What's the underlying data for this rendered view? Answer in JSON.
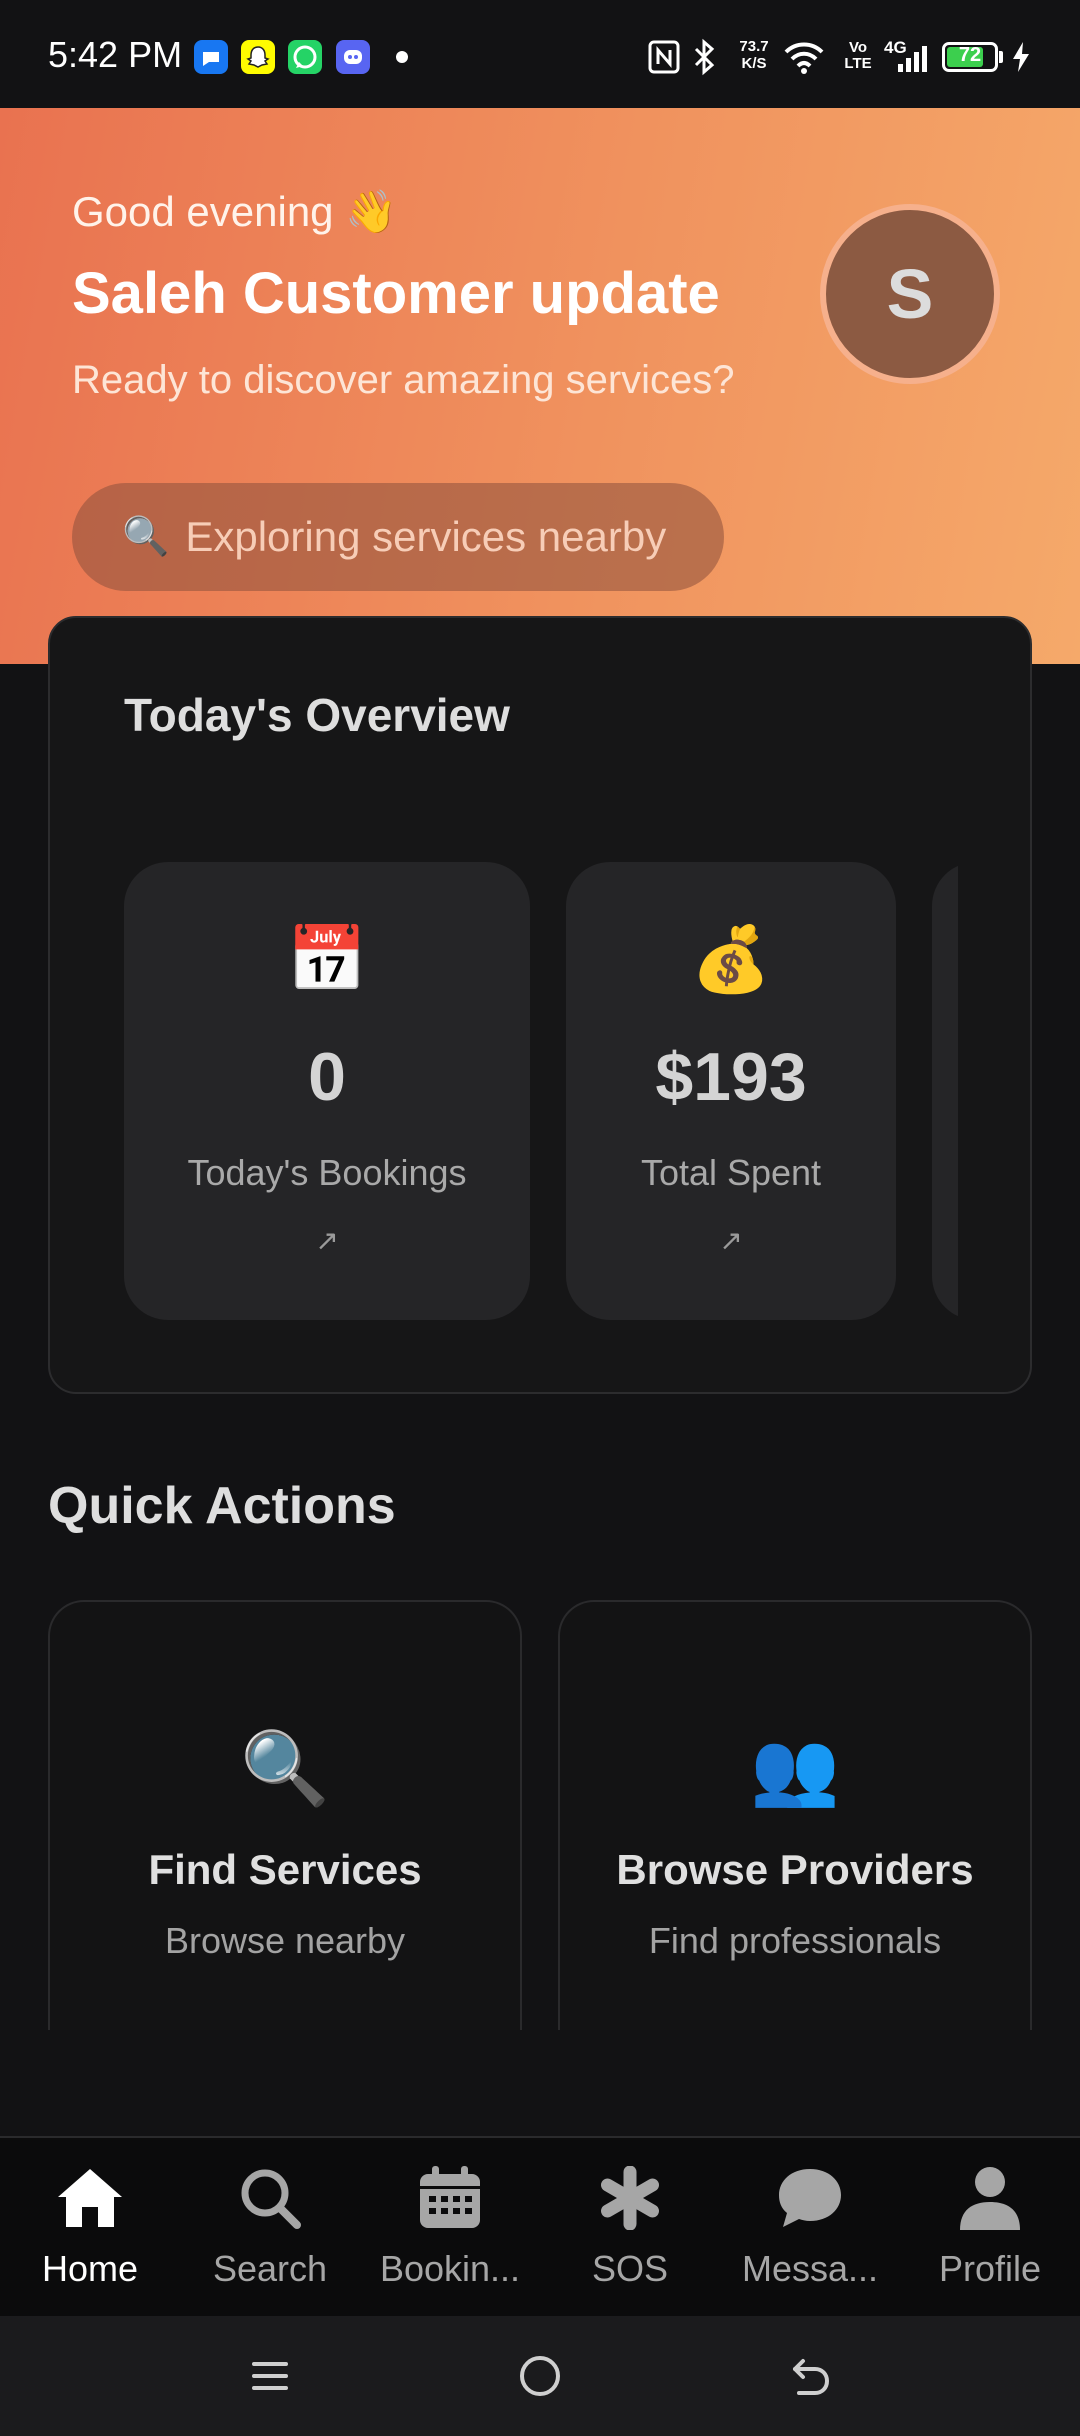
{
  "status_bar": {
    "time": "5:42 PM",
    "net_speed_value": "73.7",
    "net_speed_unit": "K/S",
    "volte_top": "Vo",
    "volte_bottom": "LTE",
    "network": "4G",
    "battery": "72",
    "battery_level": 0.72,
    "notification_icons": [
      "messenger-icon",
      "snapchat-icon",
      "whatsapp-icon",
      "discord-icon"
    ]
  },
  "header": {
    "greeting": "Good evening 👋",
    "user_name": "Saleh Customer update",
    "tagline": "Ready to discover amazing services?",
    "avatar_initial": "S",
    "explore_icon": "🔍",
    "explore_text": "Exploring services nearby"
  },
  "overview": {
    "title": "Today's Overview",
    "stats": [
      {
        "icon": "📅",
        "value": "0",
        "label": "Today's Bookings",
        "arrow": "↗"
      },
      {
        "icon": "💰",
        "value": "$193",
        "label": "Total Spent",
        "arrow": "↗"
      }
    ]
  },
  "quick_actions": {
    "title": "Quick Actions",
    "items": [
      {
        "icon": "🔍",
        "label": "Find Services",
        "sub": "Browse nearby"
      },
      {
        "icon": "👥",
        "label": "Browse Providers",
        "sub": "Find professionals"
      }
    ]
  },
  "bottom_nav": {
    "items": [
      {
        "label": "Home",
        "icon": "home-icon",
        "active": true
      },
      {
        "label": "Search",
        "icon": "search-icon",
        "active": false
      },
      {
        "label": "Bookin...",
        "icon": "calendar-icon",
        "active": false
      },
      {
        "label": "SOS",
        "icon": "asterisk-icon",
        "active": false
      },
      {
        "label": "Messa...",
        "icon": "chat-bubble-icon",
        "active": false
      },
      {
        "label": "Profile",
        "icon": "person-icon",
        "active": false
      }
    ]
  },
  "colors": {
    "header_gradient_start": "#e97250",
    "header_gradient_end": "#f5a96a",
    "background": "#121214",
    "card": "#252527",
    "battery_green": "#3ccf4e"
  }
}
